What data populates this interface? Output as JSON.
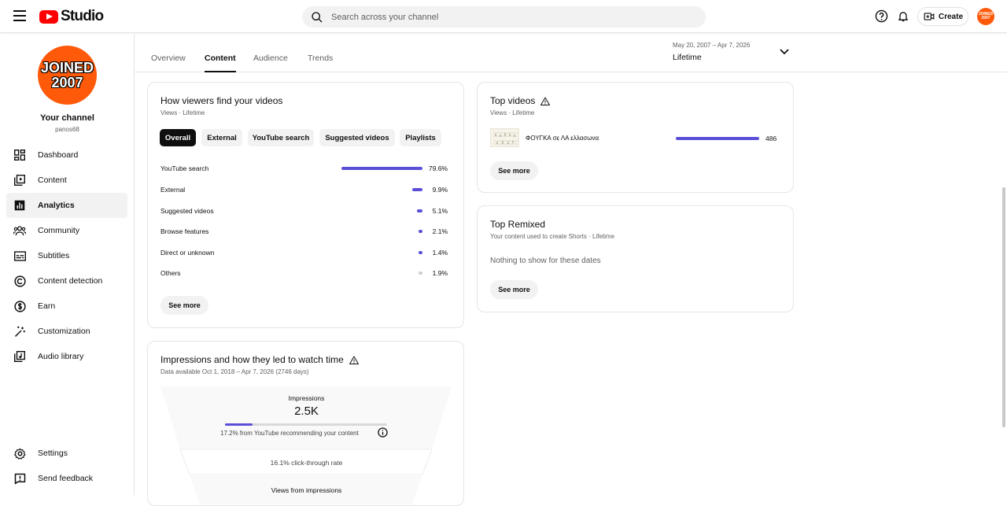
{
  "header": {
    "logo_text": "Studio",
    "search_placeholder": "Search across your channel",
    "create_label": "Create",
    "avatar_text": "JOINED 2007"
  },
  "sidebar": {
    "avatar_line1": "JOINED",
    "avatar_line2": "2007",
    "channel_name": "Your channel",
    "channel_handle": "panos68",
    "items": [
      {
        "label": "Dashboard",
        "icon": "dashboard-icon"
      },
      {
        "label": "Content",
        "icon": "content-icon"
      },
      {
        "label": "Analytics",
        "icon": "analytics-icon",
        "active": true
      },
      {
        "label": "Community",
        "icon": "community-icon"
      },
      {
        "label": "Subtitles",
        "icon": "subtitles-icon"
      },
      {
        "label": "Content detection",
        "icon": "copyright-icon"
      },
      {
        "label": "Earn",
        "icon": "dollar-icon"
      },
      {
        "label": "Customization",
        "icon": "magic-wand-icon"
      },
      {
        "label": "Audio library",
        "icon": "audio-library-icon"
      }
    ],
    "bottom_items": [
      {
        "label": "Settings",
        "icon": "gear-icon"
      },
      {
        "label": "Send feedback",
        "icon": "feedback-icon"
      }
    ]
  },
  "tabs": [
    "Overview",
    "Content",
    "Audience",
    "Trends"
  ],
  "active_tab": "Content",
  "date_range": {
    "range": "May 20, 2007 – Apr 7, 2026",
    "period": "Lifetime"
  },
  "viewers_card": {
    "title": "How viewers find your videos",
    "subtitle": "Views · Lifetime",
    "chips": [
      "Overall",
      "External",
      "YouTube search",
      "Suggested videos",
      "Playlists"
    ],
    "active_chip": "Overall",
    "rows": [
      {
        "label": "YouTube search",
        "pct": "79.6%",
        "value": 79.6
      },
      {
        "label": "External",
        "pct": "9.9%",
        "value": 9.9
      },
      {
        "label": "Suggested videos",
        "pct": "5.1%",
        "value": 5.1
      },
      {
        "label": "Browse features",
        "pct": "2.1%",
        "value": 2.1
      },
      {
        "label": "Direct or unknown",
        "pct": "1.4%",
        "value": 1.4
      },
      {
        "label": "Others",
        "pct": "1.9%",
        "value": 1.9
      }
    ],
    "see_more": "See more"
  },
  "impressions_card": {
    "title": "Impressions and how they led to watch time",
    "subtitle": "Data available Oct 1, 2018 – Apr 7, 2026 (2746 days)",
    "impressions_label": "Impressions",
    "impressions_value": "2.5K",
    "recommending_text": "17.2% from YouTube recommending your content",
    "recommending_fraction": 0.172,
    "ctr_text": "16.1% click-through rate",
    "views_label": "Views from impressions"
  },
  "top_videos_card": {
    "title": "Top videos",
    "subtitle": "Views · Lifetime",
    "videos": [
      {
        "title": "ΦΟΥΓΚΑ σε ΛΑ ελλασωνα",
        "views": "486"
      }
    ],
    "see_more": "See more"
  },
  "top_remixed_card": {
    "title": "Top Remixed",
    "subtitle": "Your content used to create Shorts · Lifetime",
    "empty_text": "Nothing to show for these dates",
    "see_more": "See more"
  }
}
